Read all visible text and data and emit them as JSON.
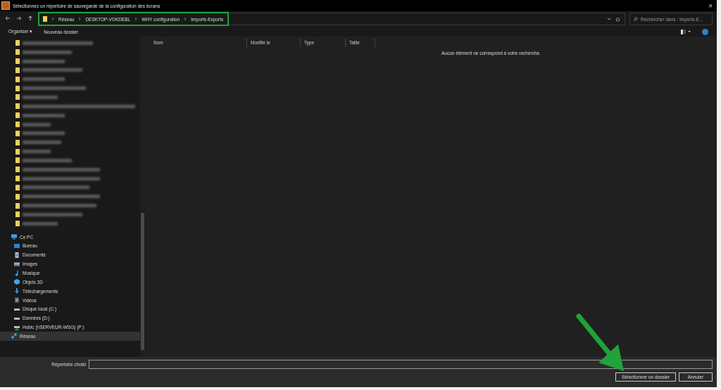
{
  "window": {
    "title": "Sélectionnez un répertoire de sauvegarde de la configuration des écrans",
    "close": "×"
  },
  "address_bar": {
    "crumbs": [
      "Réseau",
      "DESKTOP-VOKDEBL",
      "WHY configuration",
      "Imports-Exports"
    ],
    "highlighted": true
  },
  "search": {
    "placeholder": "Rechercher dans : Imports-E..."
  },
  "command_bar": {
    "items": [
      "Organiser ▾",
      "Nouveau dossier"
    ]
  },
  "sidebar": {
    "blurred_folders": [
      {
        "kind": "blurred"
      },
      {
        "kind": "blurred"
      },
      {
        "kind": "blurred"
      },
      {
        "kind": "blurred"
      },
      {
        "kind": "blurred"
      },
      {
        "kind": "blurred"
      },
      {
        "kind": "blurred"
      },
      {
        "kind": "blurred"
      },
      {
        "kind": "blurred"
      },
      {
        "kind": "blurred"
      },
      {
        "kind": "blurred"
      },
      {
        "kind": "blurred"
      },
      {
        "kind": "blurred"
      },
      {
        "kind": "blurred"
      },
      {
        "kind": "blurred"
      },
      {
        "kind": "blurred"
      },
      {
        "kind": "blurred"
      },
      {
        "kind": "blurred"
      },
      {
        "kind": "blurred"
      },
      {
        "kind": "blurred"
      },
      {
        "kind": "blurred"
      }
    ],
    "items": [
      {
        "label": "Ce PC",
        "kind": "pc",
        "selected": false,
        "children": [
          {
            "label": "Bureau",
            "kind": "desktop",
            "selected": false
          },
          {
            "label": "Documents",
            "kind": "documents",
            "selected": false
          },
          {
            "label": "Images",
            "kind": "images",
            "selected": false
          },
          {
            "label": "Musique",
            "kind": "music",
            "selected": false
          },
          {
            "label": "Objets 3D",
            "kind": "cube",
            "selected": false
          },
          {
            "label": "Téléchargements",
            "kind": "download",
            "selected": false
          },
          {
            "label": "Vidéos",
            "kind": "video",
            "selected": false
          },
          {
            "label": "Disque local (C:)",
            "kind": "drive",
            "selected": false
          },
          {
            "label": "Données (D:)",
            "kind": "drive",
            "selected": false
          },
          {
            "label": "Hubic (\\\\SERVEUR-WSG) (P:)",
            "kind": "netdrive",
            "selected": false
          }
        ]
      },
      {
        "label": "Réseau",
        "kind": "network",
        "selected": true
      }
    ]
  },
  "table": {
    "columns": [
      "Nom",
      "Modifié le",
      "Type",
      "Taille"
    ],
    "empty_message": "Aucun élément ne correspond à votre recherche."
  },
  "footer": {
    "field_label": "Répertoire choisi",
    "buttons": [
      "Sélectionner un dossier",
      "Annuler"
    ],
    "arrow": true
  }
}
